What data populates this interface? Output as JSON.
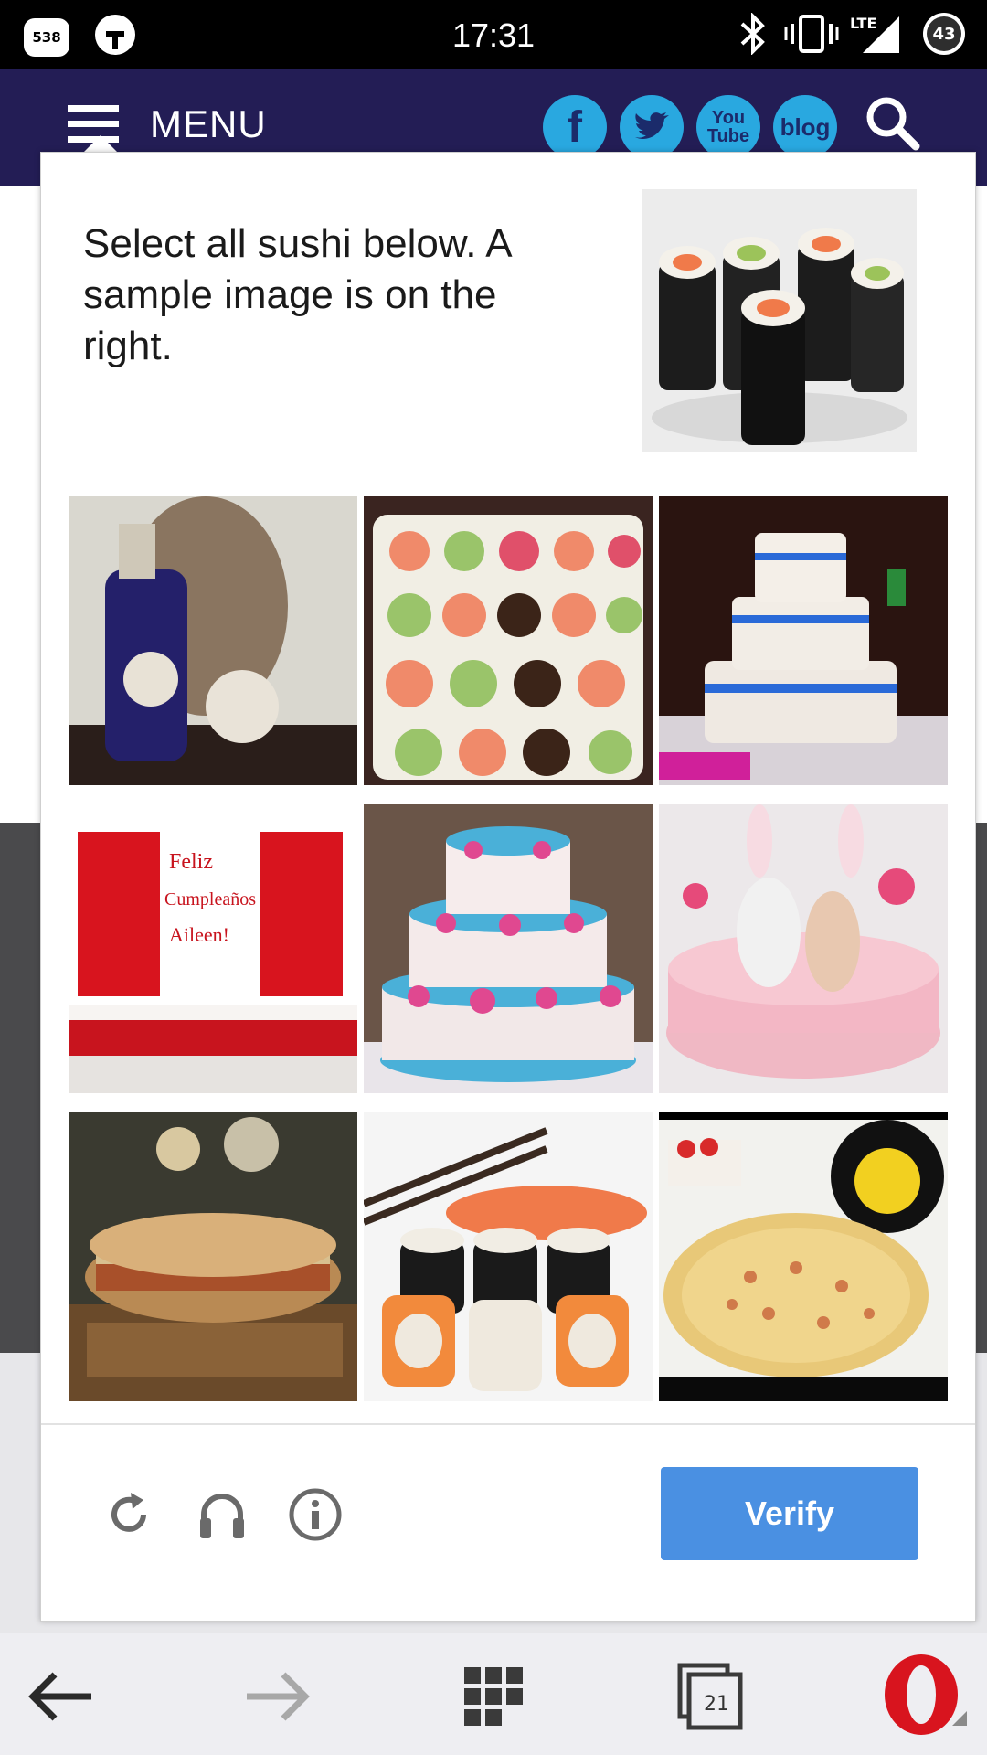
{
  "status_bar": {
    "time": "17:31",
    "notification_count": "538",
    "network": "LTE",
    "battery": "43",
    "icons": [
      "notification-badge-icon",
      "lock-icon",
      "bluetooth-icon",
      "vibrate-icon",
      "signal-icon",
      "battery-icon"
    ]
  },
  "header": {
    "menu_label": "MENU",
    "social": [
      {
        "name": "facebook",
        "label": "f"
      },
      {
        "name": "twitter",
        "label": ""
      },
      {
        "name": "youtube",
        "label": "You Tube"
      },
      {
        "name": "blog",
        "label": "blog"
      }
    ],
    "colors": {
      "background": "#231d55",
      "social": "#29a8e0"
    }
  },
  "captcha": {
    "instruction": "Select all sushi below. A sample image is on the right.",
    "sample_image": "sushi-rolls",
    "tiles": [
      {
        "subject": "perfume-bottle",
        "selected": false
      },
      {
        "subject": "sushi-tray",
        "selected": false
      },
      {
        "subject": "white-tiered-cake",
        "selected": false
      },
      {
        "subject": "red-white-flag-cake",
        "selected": false
      },
      {
        "subject": "blue-pink-floral-cake",
        "selected": false
      },
      {
        "subject": "pink-bunny-cake",
        "selected": false
      },
      {
        "subject": "sandwich",
        "selected": false
      },
      {
        "subject": "sushi-rolls",
        "selected": false
      },
      {
        "subject": "pizza",
        "selected": false
      }
    ],
    "verify_label": "Verify",
    "footer_icons": [
      "reload-icon",
      "headphones-icon",
      "info-icon"
    ],
    "colors": {
      "verify": "#4a90e2"
    }
  },
  "nav_bar": {
    "tabs_count": "21",
    "icons": [
      "back-arrow-icon",
      "forward-arrow-icon",
      "speed-dial-icon",
      "tabs-icon",
      "opera-icon"
    ]
  }
}
